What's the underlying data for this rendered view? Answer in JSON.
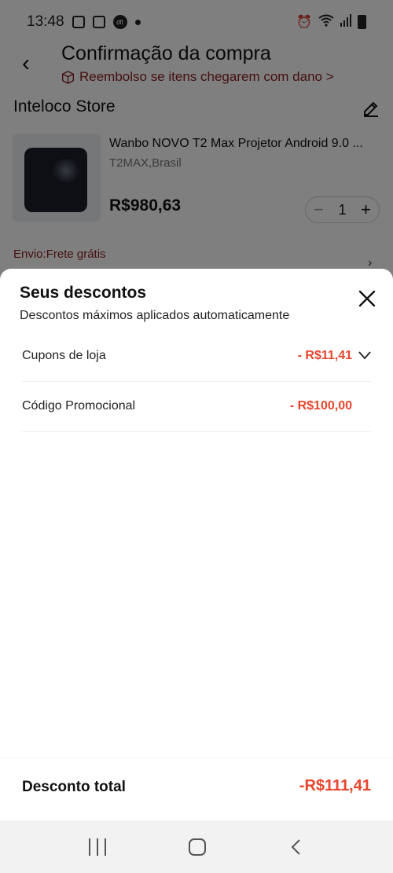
{
  "status_bar": {
    "time": "13:48",
    "dft_label": "dft"
  },
  "page": {
    "title": "Confirmação da compra",
    "refund_text": "Reembolso se itens chegarem com dano >",
    "store_name": "Inteloco Store",
    "product": {
      "name": "Wanbo NOVO T2 Max Projetor Android 9.0 ...",
      "variant": "T2MAX,Brasil",
      "price": "R$980,63",
      "quantity": "1"
    },
    "shipping": "Envio:Frete grátis"
  },
  "sheet": {
    "title": "Seus descontos",
    "subtitle": "Descontos máximos aplicados automaticamente",
    "rows": [
      {
        "label": "Cupons de loja",
        "value": "- R$11,41"
      },
      {
        "label": "Código Promocional",
        "value": "- R$100,00"
      }
    ],
    "total_label": "Desconto total",
    "total_value": "-R$111,41"
  },
  "colors": {
    "accent_red": "#e8452c",
    "refund_text": "#8a1c1c",
    "overlay": "rgba(0,0,0,0.5)"
  },
  "icons": [
    "back-arrow-icon",
    "cube-icon",
    "edit-icon",
    "close-icon",
    "chevron-down-icon",
    "recent-apps-icon",
    "home-icon",
    "nav-back-icon"
  ]
}
